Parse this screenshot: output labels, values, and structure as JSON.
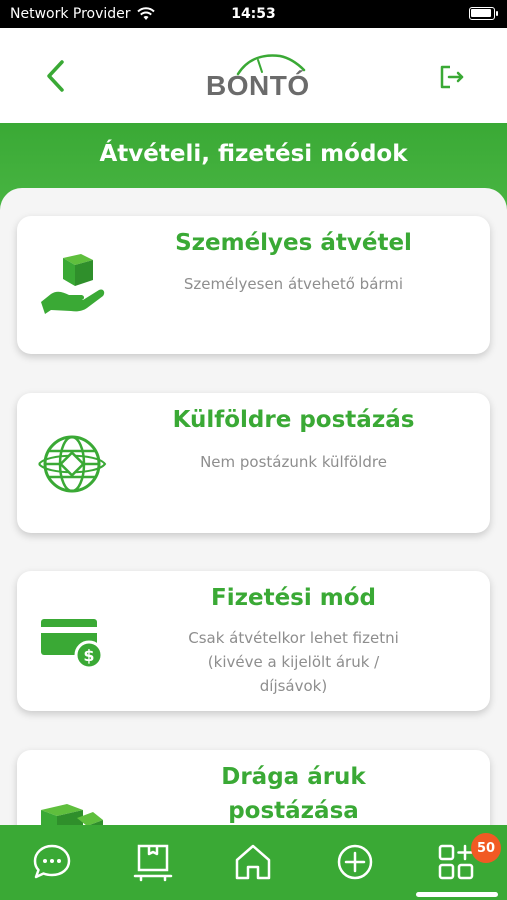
{
  "status_bar": {
    "carrier": "Network Provider",
    "time": "14:53"
  },
  "header": {
    "logo_text": "BONTÓ"
  },
  "page": {
    "title": "Átvételi, fizetési módok"
  },
  "cards": [
    {
      "title": "Személyes átvétel",
      "description": "Személyesen átvehető bármi",
      "icon": "hand-box-icon"
    },
    {
      "title": "Külföldre postázás",
      "description": "Nem postázunk külföldre",
      "icon": "globe-icon"
    },
    {
      "title": "Fizetési mód",
      "description_lines": [
        "Csak átvételkor lehet fizetni",
        "(kivéve a kijelölt áruk /",
        "díjsávok)"
      ],
      "icon": "credit-card-icon"
    },
    {
      "title_lines": [
        "Drága áruk",
        "postázása"
      ],
      "icon": "boxes-icon"
    }
  ],
  "bottom_nav": {
    "items": [
      "chat-icon",
      "package-icon",
      "home-icon",
      "add-icon",
      "apps-icon"
    ],
    "badge": "50"
  },
  "colors": {
    "primary_green": "#3aa935",
    "badge_orange": "#f15a24",
    "background": "#f5f5f5"
  }
}
